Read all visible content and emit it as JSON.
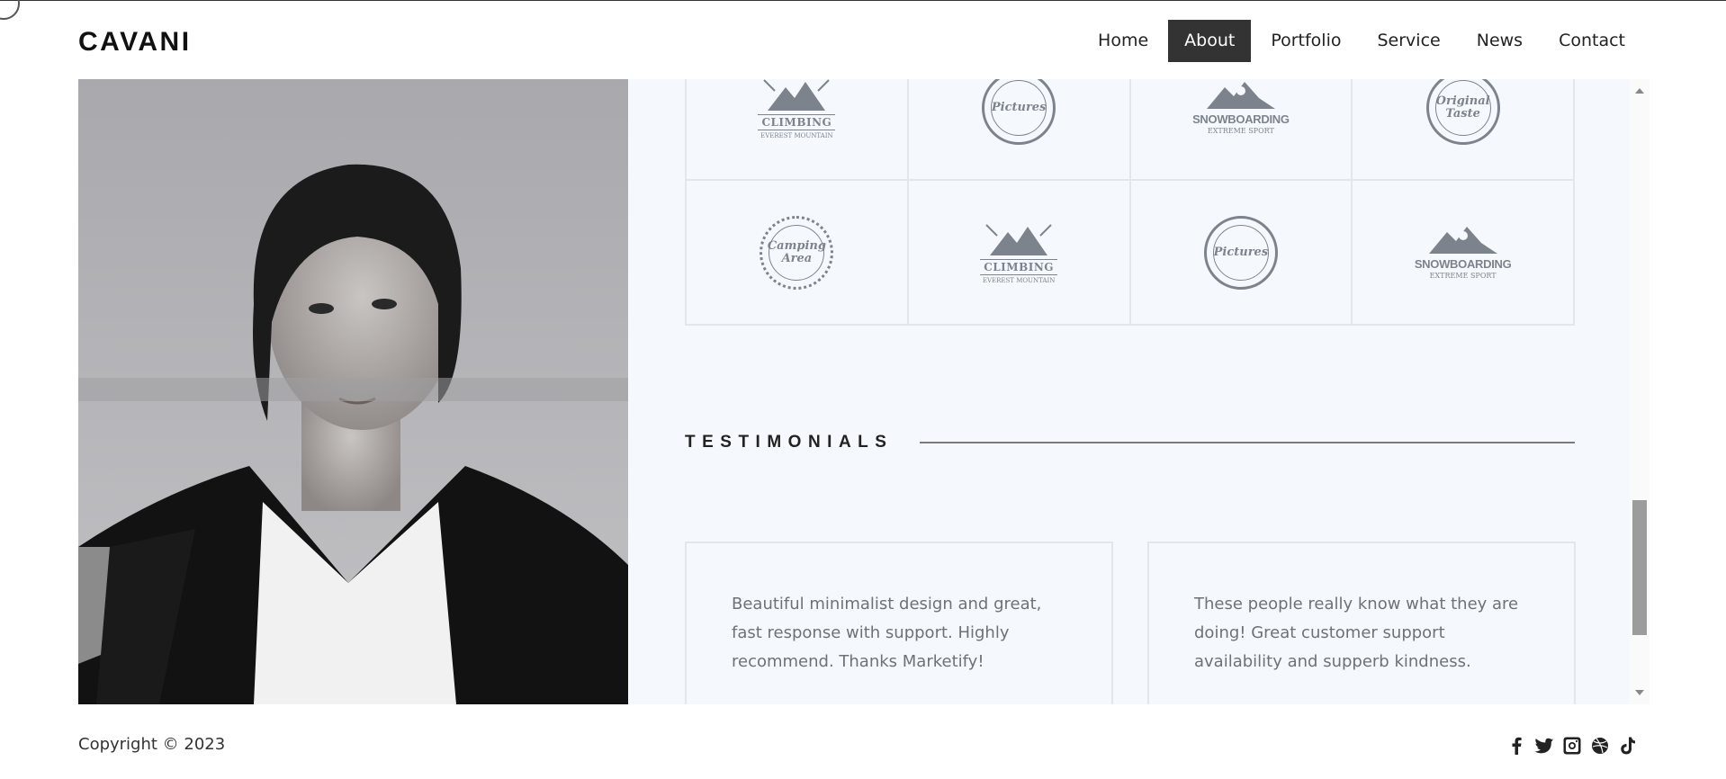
{
  "brand": {
    "logo": "CAVANI"
  },
  "nav": {
    "items": [
      {
        "label": "Home",
        "active": false
      },
      {
        "label": "About",
        "active": true
      },
      {
        "label": "Portfolio",
        "active": false
      },
      {
        "label": "Service",
        "active": false
      },
      {
        "label": "News",
        "active": false
      },
      {
        "label": "Contact",
        "active": false
      }
    ]
  },
  "partners": {
    "logos": [
      {
        "icon": "climbing-logo",
        "text": "CLIMBING",
        "sub": "EVEREST MOUNTAIN"
      },
      {
        "icon": "pictures-logo",
        "text": "Pictures"
      },
      {
        "icon": "snowboarding-logo",
        "text": "SNOWBOARDING",
        "sub": "EXTREME SPORT"
      },
      {
        "icon": "original-taste-logo",
        "text": "Original Taste"
      },
      {
        "icon": "camping-area-logo",
        "text": "Camping Area"
      },
      {
        "icon": "climbing-logo",
        "text": "CLIMBING",
        "sub": "EVEREST MOUNTAIN"
      },
      {
        "icon": "pictures-logo",
        "text": "Pictures"
      },
      {
        "icon": "snowboarding-logo",
        "text": "SNOWBOARDING",
        "sub": "EXTREME SPORT"
      }
    ]
  },
  "testimonials": {
    "title": "TESTIMONIALS",
    "items": [
      {
        "text": "Beautiful minimalist design and great, fast response with support. Highly recommend. Thanks Marketify!"
      },
      {
        "text": "These people really know what they are doing! Great customer support availability and supperb kindness."
      }
    ]
  },
  "footer": {
    "copyright": "Copyright © 2023",
    "socials": [
      "facebook-icon",
      "twitter-icon",
      "instagram-icon",
      "dribbble-icon",
      "tiktok-icon"
    ]
  },
  "colors": {
    "panel_bg": "#f5f9fd",
    "nav_active_bg": "#333333",
    "logo_gray": "#7d838d"
  }
}
